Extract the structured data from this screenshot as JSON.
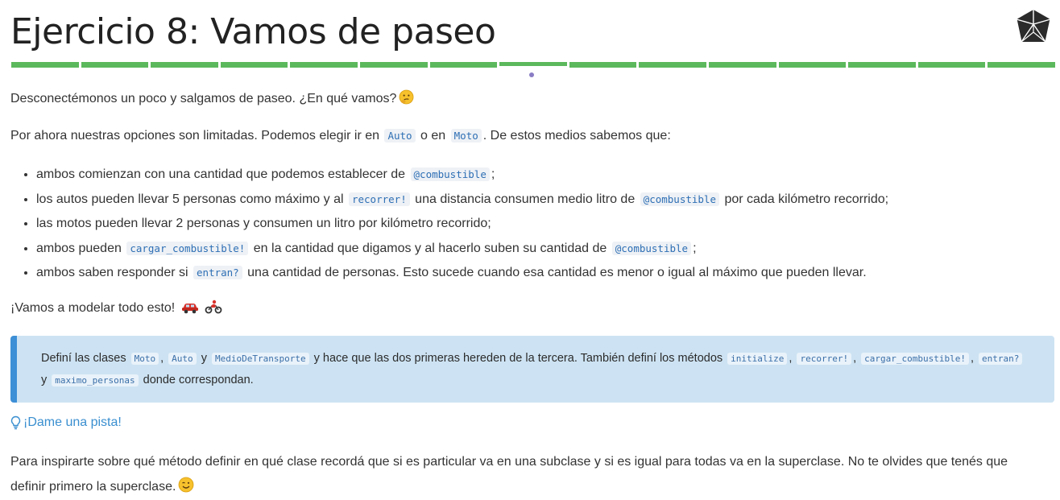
{
  "header": {
    "title": "Ejercicio 8: Vamos de paseo",
    "logo_icon": "ruby-gem-icon",
    "progress": {
      "total": 15,
      "current": 8,
      "color": "#5cb85c"
    }
  },
  "intro": {
    "line1": "Desconectémonos un poco y salgamos de paseo. ¿En qué vamos?",
    "line1_emoji": "thinking-face-icon",
    "line2_a": "Por ahora nuestras opciones son limitadas. Podemos elegir ir en",
    "line2_code1": "Auto",
    "line2_b": "o en",
    "line2_code2": "Moto",
    "line2_c": ". De estos medios sabemos que:"
  },
  "bullets": [
    {
      "a": "ambos comienzan con una cantidad que podemos establecer de",
      "code1": "@combustible",
      "b": ";"
    },
    {
      "a": "los autos pueden llevar 5 personas como máximo y al",
      "code1": "recorrer!",
      "b": "una distancia consumen medio litro de",
      "code2": "@combustible",
      "c": "por cada kilómetro recorrido;"
    },
    {
      "a": "las motos pueden llevar 2 personas y consumen un litro por kilómetro recorrido;"
    },
    {
      "a": "ambos pueden",
      "code1": "cargar_combustible!",
      "b": "en la cantidad que digamos y al hacerlo suben su cantidad de",
      "code2": "@combustible",
      "c": ";"
    },
    {
      "a": "ambos saben responder si",
      "code1": "entran?",
      "b": "una cantidad de personas. Esto sucede cuando esa cantidad es menor o igual al máximo que pueden llevar."
    }
  ],
  "closing": {
    "text": "¡Vamos a modelar todo esto!",
    "emoji1": "car-icon",
    "emoji2": "motorcycle-icon"
  },
  "callout": {
    "a": "Definí las clases",
    "c1": "Moto",
    "s1": ",",
    "c2": "Auto",
    "s2": "y",
    "c3": "MedioDeTransporte",
    "b": "y hace que las dos primeras hereden de la tercera. También definí los métodos",
    "c4": "initialize",
    "s3": ",",
    "c5": "recorrer!",
    "s4": ",",
    "c6": "cargar_combustible!",
    "s5": ",",
    "c7": "entran?",
    "s6": "y",
    "c8": "maximo_personas",
    "d": "donde correspondan."
  },
  "hint": {
    "label": "¡Dame una pista!",
    "icon": "lightbulb-icon"
  },
  "hint_text": {
    "text": "Para inspirarte sobre qué método definir en qué clase recordá que si es particular va en una subclase y si es igual para todas va en la superclase. No te olvides que tenés que definir primero la superclase.",
    "emoji": "winking-face-icon"
  }
}
